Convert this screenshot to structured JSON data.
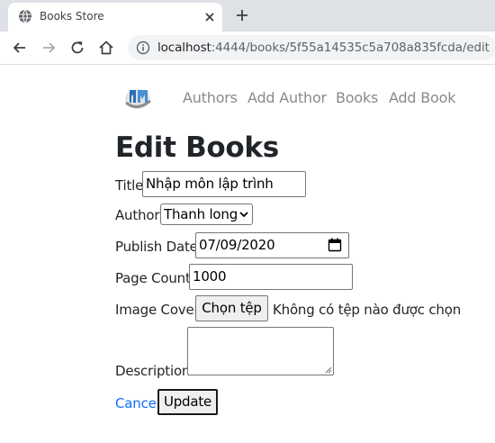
{
  "browser": {
    "tab_title": "Books Store",
    "url_host": "localhost",
    "url_path": ":4444/books/5f55a14535c5a708a835fcda/edit",
    "icons": {
      "favicon": "globe-icon",
      "tab_close": "close-icon",
      "new_tab": "plus-icon",
      "back": "back-arrow-icon",
      "forward": "forward-arrow-icon",
      "reload": "reload-icon",
      "home": "home-icon",
      "site_info": "info-icon"
    }
  },
  "nav": {
    "links": [
      "Authors",
      "Add Author",
      "Books",
      "Add Book"
    ]
  },
  "form": {
    "heading": "Edit Books",
    "title": {
      "label": "Title",
      "value": "Nhập môn lập trình"
    },
    "author": {
      "label": "Author",
      "selected": "Thanh long"
    },
    "publish_date": {
      "label": "Publish Date",
      "value": "07/09/2020"
    },
    "page_count": {
      "label": "Page Count",
      "value": "1000"
    },
    "image_cover": {
      "label": "Image Cover",
      "button": "Chọn tệp",
      "status": "Không có tệp nào được chọn"
    },
    "description": {
      "label": "Description",
      "value": ""
    },
    "cancel_label": "Cancel",
    "update_label": "Update"
  },
  "colors": {
    "link": "#0d6efd",
    "nav_link": "#8a8a8a",
    "tabstrip": "#dee1e6",
    "omnibox": "#f1f3f4"
  }
}
